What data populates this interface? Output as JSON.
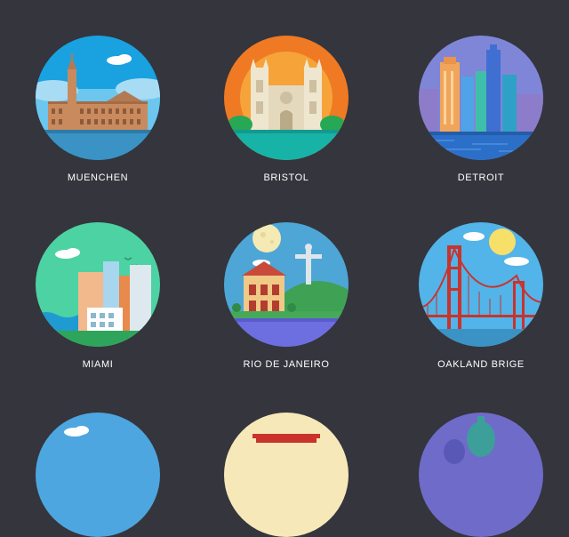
{
  "cities": [
    {
      "name": "MUENCHEN"
    },
    {
      "name": "BRISTOL"
    },
    {
      "name": "DETROIT"
    },
    {
      "name": "MIAMI"
    },
    {
      "name": "RIO DE JANEIRO"
    },
    {
      "name": "OAKLAND BRIGE"
    }
  ],
  "colors": {
    "background": "#34353d",
    "label": "#ffffff"
  }
}
